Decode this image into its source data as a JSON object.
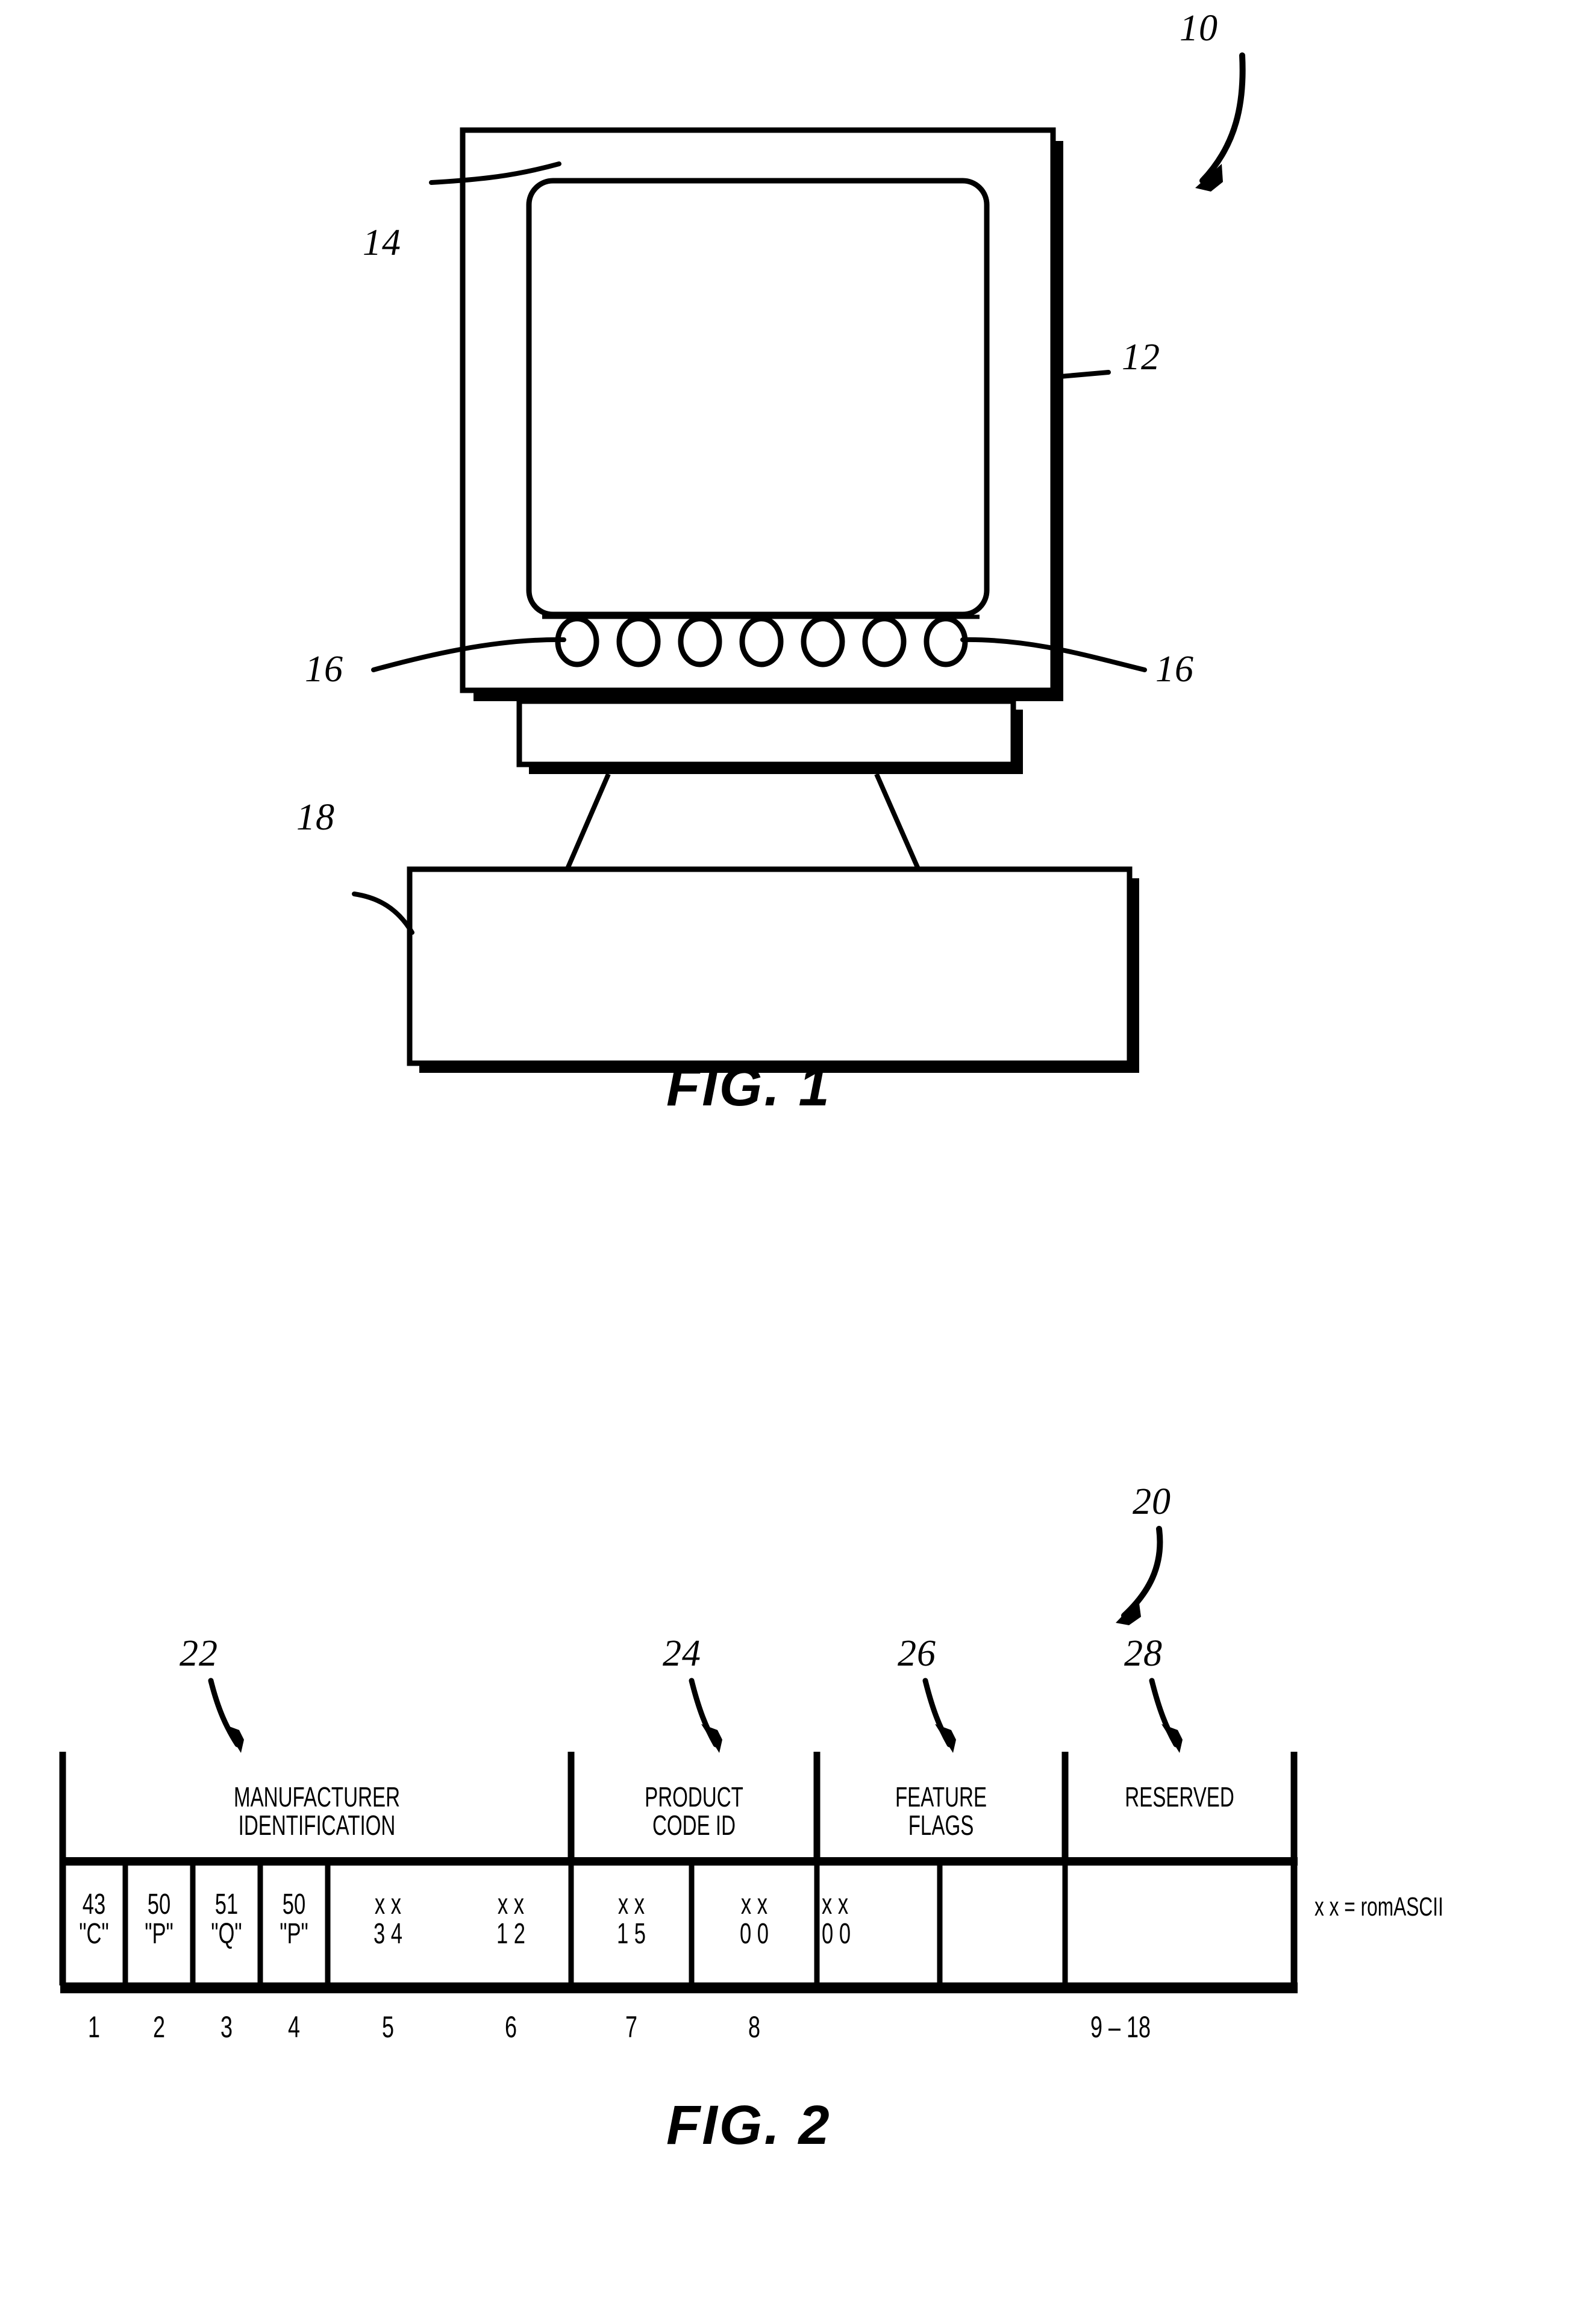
{
  "document": {
    "type": "patent-drawing-sheet",
    "background_color": "#ffffff",
    "ink_color": "#000000"
  },
  "figure1": {
    "caption": "FIG. 1",
    "callouts": [
      {
        "id": "fig1-ref-10",
        "label": "10",
        "target": "display-system-assembly"
      },
      {
        "id": "fig1-ref-12",
        "label": "12",
        "target": "monitor-housing"
      },
      {
        "id": "fig1-ref-14",
        "label": "14",
        "target": "display-screen"
      },
      {
        "id": "fig1-ref-16-left",
        "label": "16",
        "target": "control-button"
      },
      {
        "id": "fig1-ref-16-right",
        "label": "16",
        "target": "control-button"
      },
      {
        "id": "fig1-ref-18",
        "label": "18",
        "target": "computer-base-unit"
      }
    ],
    "button_count": 7
  },
  "figure2": {
    "caption": "FIG. 2",
    "callouts": [
      {
        "id": "fig2-ref-20",
        "label": "20",
        "target": "data-structure"
      },
      {
        "id": "fig2-ref-22",
        "label": "22",
        "target": "manufacturer-identification-field"
      },
      {
        "id": "fig2-ref-24",
        "label": "24",
        "target": "product-code-id-field"
      },
      {
        "id": "fig2-ref-26",
        "label": "26",
        "target": "feature-flags-field"
      },
      {
        "id": "fig2-ref-28",
        "label": "28",
        "target": "reserved-field"
      }
    ],
    "legend": "x x = romASCII",
    "headers": [
      {
        "lines": [
          "MANUFACTURER",
          "IDENTIFICATION"
        ],
        "span": 4
      },
      {
        "lines": [
          "PRODUCT",
          "CODE ID"
        ],
        "span": 2
      },
      {
        "lines": [
          "FEATURE",
          "FLAGS"
        ],
        "span": 2
      },
      {
        "lines": [
          "RESERVED"
        ],
        "span": 1
      }
    ],
    "cells": [
      {
        "top": "43",
        "bottom": "\"C\""
      },
      {
        "top": "50",
        "bottom": "\"P\""
      },
      {
        "top": "51",
        "bottom": "\"Q\""
      },
      {
        "top": "50",
        "bottom": "\"P\""
      },
      {
        "top": "x x",
        "bottom": "3 4"
      },
      {
        "top": "x x",
        "bottom": "1 2"
      },
      {
        "top": "x x",
        "bottom": "1 5"
      },
      {
        "top": "x x",
        "bottom": "0 0"
      },
      {
        "top": "x x",
        "bottom": "0 0"
      }
    ],
    "byte_indices": [
      "1",
      "2",
      "3",
      "4",
      "5",
      "6",
      "7",
      "8",
      "9 – 18"
    ]
  }
}
